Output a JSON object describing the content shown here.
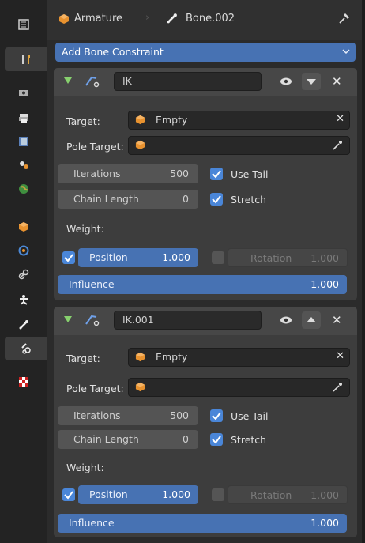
{
  "header": {
    "object": "Armature",
    "bone": "Bone.002"
  },
  "add_button": {
    "label": "Add Bone Constraint"
  },
  "sidebar": {
    "tabs": [
      "tool-icon",
      "render-icon",
      "output-icon",
      "view-layer-icon",
      "scene-icon",
      "world-icon",
      "object-icon",
      "physics-icon",
      "constraints-icon",
      "data-icon",
      "bone-icon",
      "bone-constraint-icon",
      "texture-icon"
    ]
  },
  "constraints": [
    {
      "name": "IK",
      "target_label": "Target:",
      "target_value": "Empty",
      "pole_label": "Pole Target:",
      "iterations_label": "Iterations",
      "iterations_value": "500",
      "chain_label": "Chain Length",
      "chain_value": "0",
      "use_tail_label": "Use Tail",
      "use_tail": true,
      "stretch_label": "Stretch",
      "stretch": true,
      "weight_label": "Weight:",
      "position_label": "Position",
      "position_value": "1.000",
      "position_checked": true,
      "rotation_label": "Rotation",
      "rotation_value": "1.000",
      "rotation_checked": false,
      "influence_label": "Influence",
      "influence_value": "1.000",
      "expanded_arrow": "down"
    },
    {
      "name": "IK.001",
      "target_label": "Target:",
      "target_value": "Empty",
      "pole_label": "Pole Target:",
      "iterations_label": "Iterations",
      "iterations_value": "500",
      "chain_label": "Chain Length",
      "chain_value": "0",
      "use_tail_label": "Use Tail",
      "use_tail": true,
      "stretch_label": "Stretch",
      "stretch": true,
      "weight_label": "Weight:",
      "position_label": "Position",
      "position_value": "1.000",
      "position_checked": true,
      "rotation_label": "Rotation",
      "rotation_value": "1.000",
      "rotation_checked": false,
      "influence_label": "Influence",
      "influence_value": "1.000",
      "expanded_arrow": "up"
    }
  ],
  "colors": {
    "accent": "#4772b3",
    "checkbox": "#4a86d8",
    "object_orange": "#e8922f",
    "enable_green": "#87d16e"
  }
}
